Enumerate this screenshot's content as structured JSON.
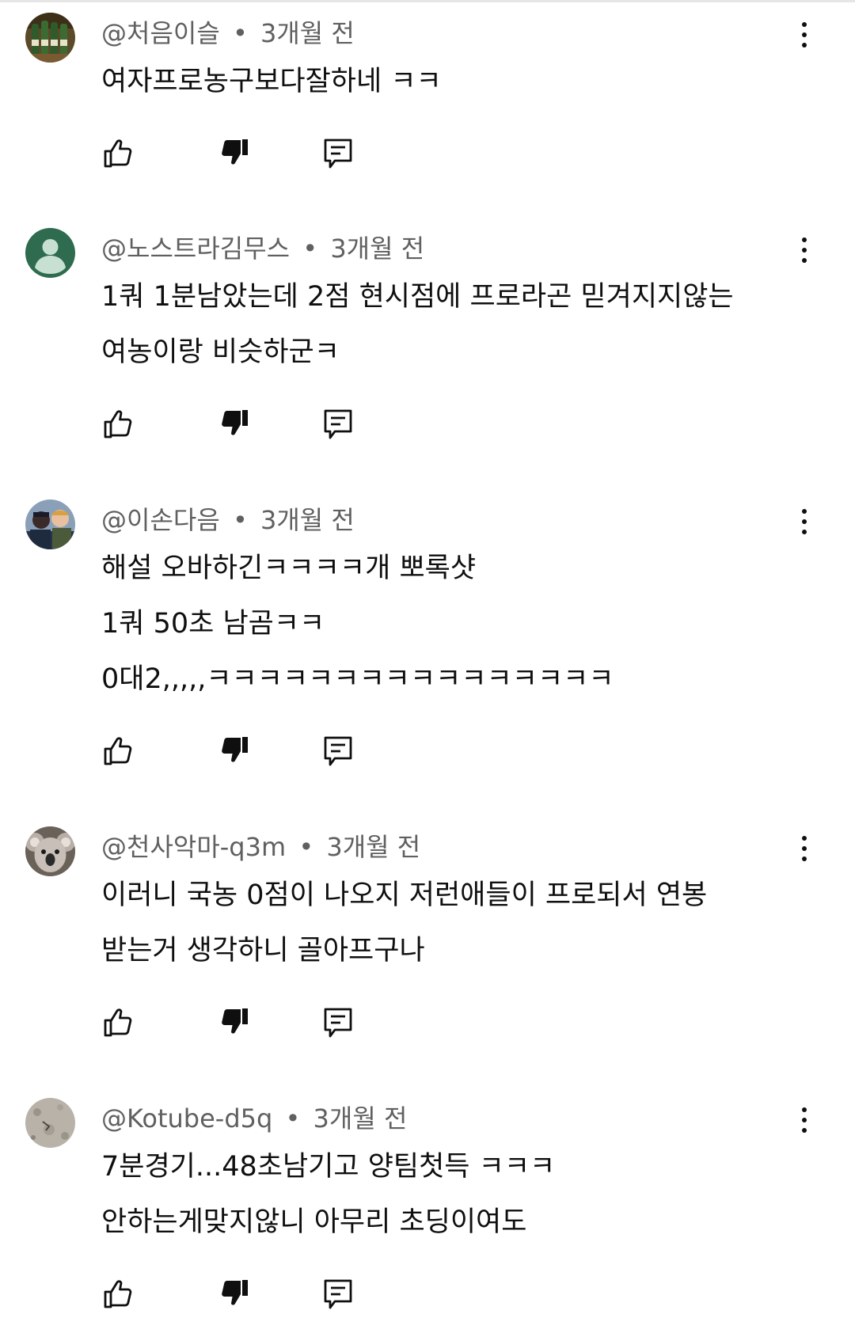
{
  "separator": "•",
  "comments": [
    {
      "author": "@처음이슬",
      "time": "3개월 전",
      "avatar_icon": "bottles-photo-avatar",
      "lines": [
        "여자프로농구보다잘하네 ㅋㅋ"
      ]
    },
    {
      "author": "@노스트라김무스",
      "time": "3개월 전",
      "avatar_icon": "default-person-avatar",
      "lines": [
        "1쿼 1분남았는데 2점 현시점에 프로라곤 믿겨지지않는",
        "여농이랑 비슷하군ㅋ"
      ]
    },
    {
      "author": "@이손다음",
      "time": "3개월 전",
      "avatar_icon": "people-photo-avatar",
      "lines": [
        "해설 오바하긴ㅋㅋㅋㅋ개 뽀록샷",
        "1쿼 50초 남곰ㅋㅋ",
        "0대2,,,,,ㅋㅋㅋㅋㅋㅋㅋㅋㅋㅋㅋㅋㅋㅋㅋㅋ"
      ]
    },
    {
      "author": "@천사악마-q3m",
      "time": "3개월 전",
      "avatar_icon": "koala-photo-avatar",
      "lines": [
        "이러니 국농 0점이 나오지 저런애들이 프로되서 연봉",
        "받는거 생각하니 골아프구나"
      ]
    },
    {
      "author": "@Kotube-d5q",
      "time": "3개월 전",
      "avatar_icon": "sand-photo-avatar",
      "lines": [
        "7분경기...48초남기고 양팀첫득  ㅋㅋㅋ",
        "안하는게맞지않니 아무리 초딩이여도"
      ]
    }
  ]
}
